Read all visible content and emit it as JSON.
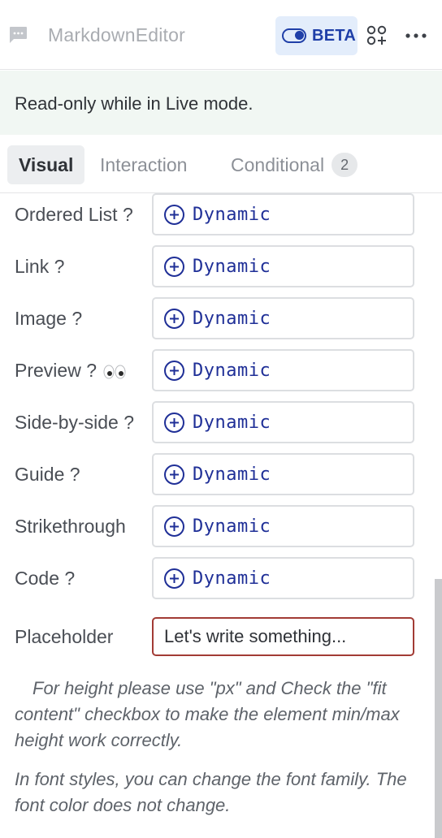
{
  "header": {
    "component_icon": "chat-bubble-icon",
    "component_name": "MarkdownEditor",
    "beta_icon": "toggle-icon",
    "beta_label": "BETA",
    "group_icon": "group-add-icon",
    "more_icon": "more-horizontal-icon"
  },
  "notice": {
    "text": "Read-only while in Live mode."
  },
  "tabs": [
    {
      "label": "Visual",
      "active": true
    },
    {
      "label": "Interaction",
      "active": false
    },
    {
      "label": "Conditional",
      "badge": "2",
      "active": false
    }
  ],
  "properties": [
    {
      "label": "Ordered List ?",
      "value": "Dynamic"
    },
    {
      "label": "Link ?",
      "value": "Dynamic"
    },
    {
      "label": "Image ?",
      "value": "Dynamic"
    },
    {
      "label": "Preview ?",
      "emoji_icon": "eyes-icon",
      "value": "Dynamic"
    },
    {
      "label": "Side-by-side ?",
      "value": "Dynamic"
    },
    {
      "label": "Guide ?",
      "value": "Dynamic"
    },
    {
      "label": "Strikethrough",
      "value": "Dynamic"
    },
    {
      "label": "Code ?",
      "value": "Dynamic"
    }
  ],
  "placeholder": {
    "label": "Placeholder",
    "value": "Let's write something..."
  },
  "notes": [
    "For height please use \"px\" and Check the \"fit content\" checkbox to make the element min/max height work correctly.",
    "In font styles, you can change the font family. The font color does not change."
  ],
  "colors": {
    "accent": "#1f3fa8",
    "dynamic_text": "#1f2f97",
    "notice_bg": "#f1f7f3",
    "placeholder_border": "#a23b35"
  }
}
